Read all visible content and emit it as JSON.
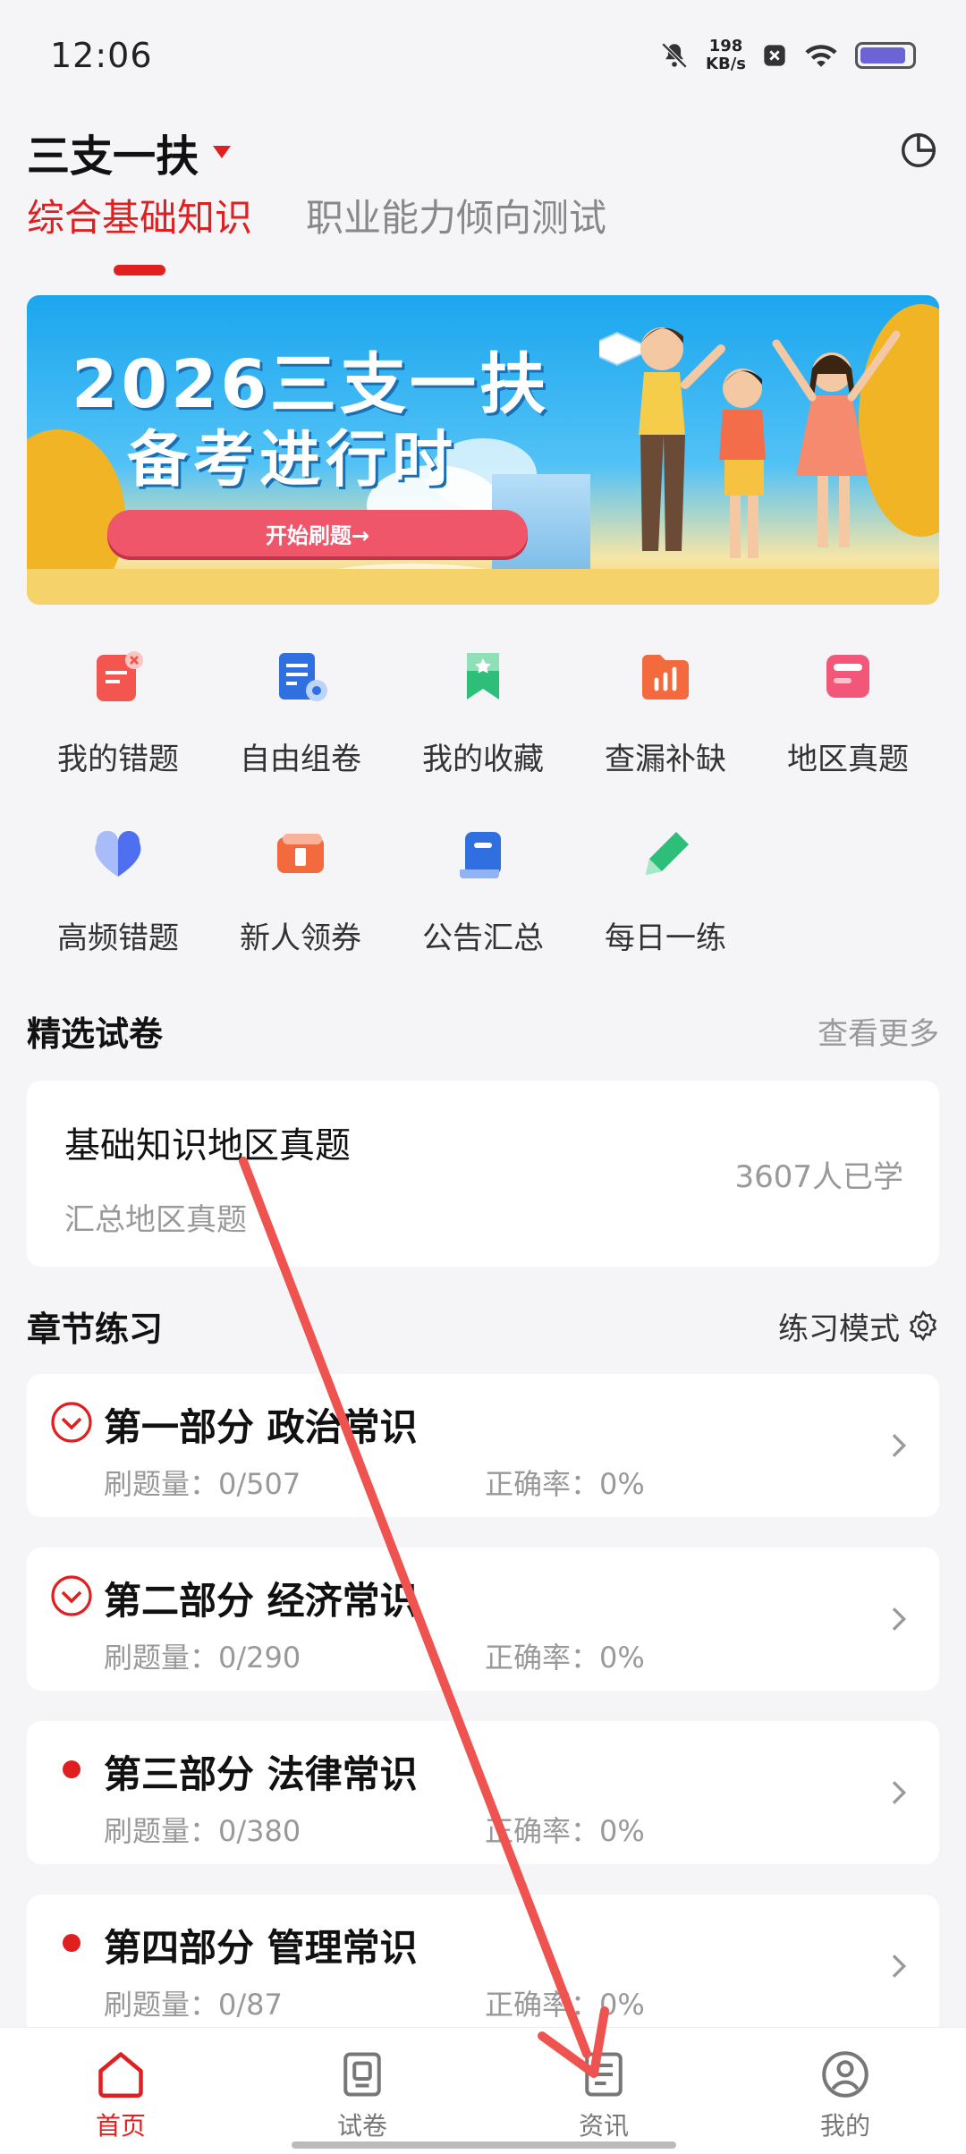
{
  "status_bar": {
    "time": "12:06",
    "net_speed_value": "198",
    "net_speed_unit": "KB/s",
    "icons": [
      "mute-icon",
      "close-badge-icon",
      "wifi-icon",
      "battery-icon"
    ],
    "battery_level": 0.9
  },
  "header": {
    "title": "三支一扶",
    "right_icon": "pie-chart-icon"
  },
  "tabs": [
    {
      "label": "综合基础知识",
      "active": true
    },
    {
      "label": "职业能力倾向测试",
      "active": false
    }
  ],
  "banner": {
    "line1": "2026三支一扶",
    "line2": "备考进行时",
    "cta": "开始刷题→"
  },
  "quick_actions": [
    {
      "label": "我的错题",
      "icon": "wrong-questions-icon",
      "color": "#f2564f"
    },
    {
      "label": "自由组卷",
      "icon": "custom-paper-icon",
      "color": "#2f6fe0"
    },
    {
      "label": "我的收藏",
      "icon": "bookmark-icon",
      "color": "#2dbf7a"
    },
    {
      "label": "查漏补缺",
      "icon": "folder-chart-icon",
      "color": "#f26a3d"
    },
    {
      "label": "地区真题",
      "icon": "region-exam-icon",
      "color": "#f2577a"
    },
    {
      "label": "高频错题",
      "icon": "heart-icon",
      "color": "#4d6ff0"
    },
    {
      "label": "新人领券",
      "icon": "coupon-icon",
      "color": "#f26a3d"
    },
    {
      "label": "公告汇总",
      "icon": "notice-icon",
      "color": "#2f6fe0"
    },
    {
      "label": "每日一练",
      "icon": "pencil-icon",
      "color": "#2dbf7a"
    }
  ],
  "featured": {
    "section_title": "精选试卷",
    "more": "查看更多",
    "card_title": "基础知识地区真题",
    "card_subtitle": "汇总地区真题",
    "card_count": "3607人已学"
  },
  "chapters": {
    "section_title": "章节练习",
    "mode_label": "练习模式",
    "items": [
      {
        "title": "第一部分  政治常识",
        "count": "刷题量：0/507",
        "accuracy": "正确率：0%",
        "marker": "expand"
      },
      {
        "title": "第二部分 经济常识",
        "count": "刷题量：0/290",
        "accuracy": "正确率：0%",
        "marker": "expand"
      },
      {
        "title": "第三部分  法律常识",
        "count": "刷题量：0/380",
        "accuracy": "正确率：0%",
        "marker": "dot"
      },
      {
        "title": "第四部分  管理常识",
        "count": "刷题量：0/87",
        "accuracy": "正确率：0%",
        "marker": "dot"
      }
    ]
  },
  "bottom_nav": [
    {
      "label": "首页",
      "icon": "home-icon",
      "active": true
    },
    {
      "label": "试卷",
      "icon": "paper-icon",
      "active": false
    },
    {
      "label": "资讯",
      "icon": "news-icon",
      "active": false
    },
    {
      "label": "我的",
      "icon": "profile-icon",
      "active": false
    }
  ],
  "colors": {
    "accent": "#e02020",
    "background": "#f5f5f7",
    "annotation": "#ee5350"
  }
}
